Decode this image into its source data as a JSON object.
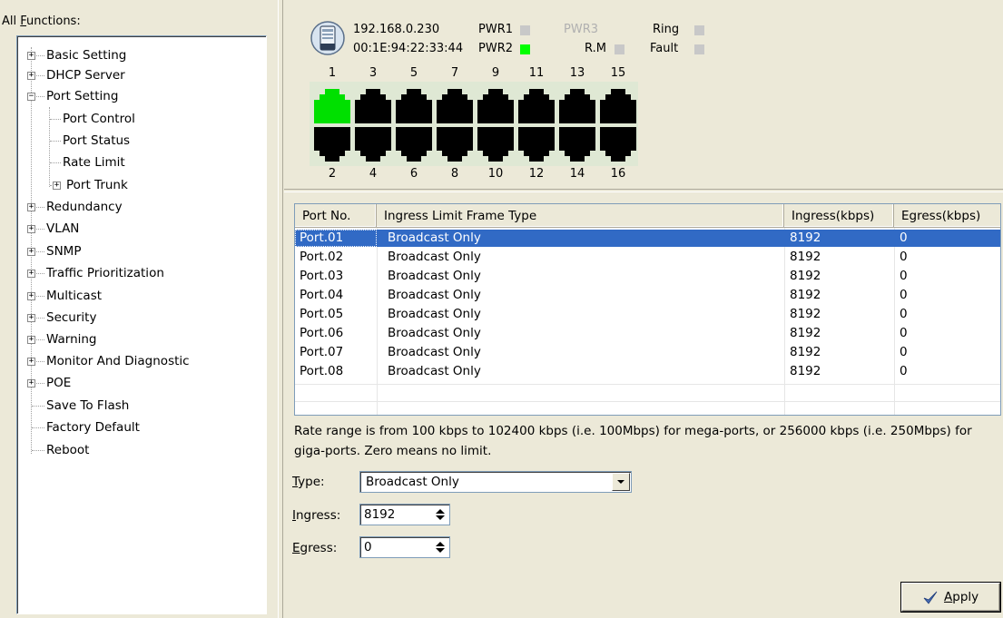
{
  "sidebar": {
    "title_prefix": "All ",
    "title_access": "F",
    "title_rest": "unctions:",
    "items": [
      {
        "label": "Basic Setting",
        "expander": "+"
      },
      {
        "label": "DHCP Server",
        "expander": "+"
      },
      {
        "label": "Port Setting",
        "expander": "-"
      },
      {
        "label": "Port Control"
      },
      {
        "label": "Port Status"
      },
      {
        "label": "Rate Limit"
      },
      {
        "label": "Port Trunk",
        "expander": "+"
      },
      {
        "label": "Redundancy",
        "expander": "+"
      },
      {
        "label": "VLAN",
        "expander": "+"
      },
      {
        "label": "SNMP",
        "expander": "+"
      },
      {
        "label": "Traffic Prioritization",
        "expander": "+"
      },
      {
        "label": "Multicast",
        "expander": "+"
      },
      {
        "label": "Security",
        "expander": "+"
      },
      {
        "label": "Warning",
        "expander": "+"
      },
      {
        "label": "Monitor And Diagnostic",
        "expander": "+"
      },
      {
        "label": "POE",
        "expander": "+"
      },
      {
        "label": "Save To Flash"
      },
      {
        "label": "Factory Default"
      },
      {
        "label": "Reboot"
      }
    ]
  },
  "device": {
    "ip": "192.168.0.230",
    "mac": "00:1E:94:22:33:44",
    "pwr1": "PWR1",
    "pwr2": "PWR2",
    "pwr3": "PWR3",
    "rm": "R.M",
    "ring": "Ring",
    "fault": "Fault",
    "colors": {
      "led_on": "#00ff00",
      "led_off": "#c8c8c8",
      "port_active": "#00e000",
      "port_idle": "#000000",
      "board": "#dfe8d4"
    },
    "top_ports": [
      "1",
      "3",
      "5",
      "7",
      "9",
      "11",
      "13",
      "15"
    ],
    "bottom_ports": [
      "2",
      "4",
      "6",
      "8",
      "10",
      "12",
      "14",
      "16"
    ]
  },
  "table": {
    "headers": {
      "port": "Port No.",
      "type": "Ingress Limit Frame Type",
      "ingress": "Ingress(kbps)",
      "egress": "Egress(kbps)"
    },
    "rows": [
      {
        "port": "Port.01",
        "type": "Broadcast Only",
        "ingress": "8192",
        "egress": "0"
      },
      {
        "port": "Port.02",
        "type": "Broadcast Only",
        "ingress": "8192",
        "egress": "0"
      },
      {
        "port": "Port.03",
        "type": "Broadcast Only",
        "ingress": "8192",
        "egress": "0"
      },
      {
        "port": "Port.04",
        "type": "Broadcast Only",
        "ingress": "8192",
        "egress": "0"
      },
      {
        "port": "Port.05",
        "type": "Broadcast Only",
        "ingress": "8192",
        "egress": "0"
      },
      {
        "port": "Port.06",
        "type": "Broadcast Only",
        "ingress": "8192",
        "egress": "0"
      },
      {
        "port": "Port.07",
        "type": "Broadcast Only",
        "ingress": "8192",
        "egress": "0"
      },
      {
        "port": "Port.08",
        "type": "Broadcast Only",
        "ingress": "8192",
        "egress": "0"
      }
    ],
    "selected_color": "#316ac5"
  },
  "note": {
    "line1": "Rate range is from 100 kbps to 102400 kbps (i.e. 100Mbps) for mega-ports, or 256000 kbps (i.e. 250Mbps) for",
    "line2": "giga-ports. Zero means no limit."
  },
  "form": {
    "type_access": "T",
    "type_rest": "ype:",
    "type_value": "Broadcast Only",
    "ingress_access": "I",
    "ingress_rest": "ngress:",
    "ingress_value": "8192",
    "egress_access": "E",
    "egress_rest": "gress:",
    "egress_value": "0",
    "apply_access": "A",
    "apply_rest": "pply"
  }
}
